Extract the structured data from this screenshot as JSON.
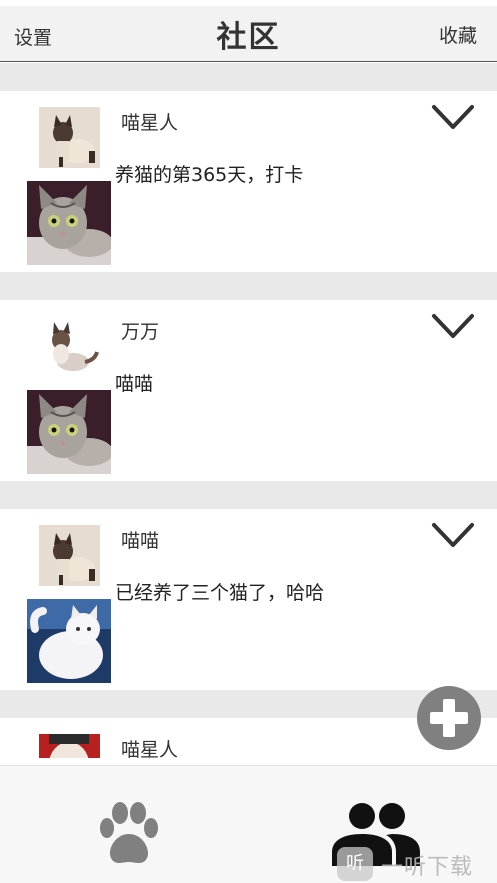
{
  "nav": {
    "left_label": "设置",
    "title": "社区",
    "right_label": "收藏"
  },
  "posts": [
    {
      "username": "喵星人",
      "text": "养猫的第365天，打卡",
      "avatar_icon": "siamese-cat-photo",
      "photo_icon": "tabby-cat-photo"
    },
    {
      "username": "万万",
      "text": "喵喵",
      "avatar_icon": "ragdoll-cat-photo",
      "photo_icon": "tabby-cat-photo"
    },
    {
      "username": "喵喵",
      "text": "已经养了三个猫了，哈哈",
      "avatar_icon": "siamese-cat-photo",
      "photo_icon": "white-persian-cat-photo"
    },
    {
      "username": "喵星人",
      "text": "",
      "avatar_icon": "cartoon-avatar-photo",
      "photo_icon": ""
    }
  ],
  "fab": {
    "icon": "plus-icon"
  },
  "tabs": [
    {
      "icon": "paw-icon"
    },
    {
      "icon": "users-icon"
    }
  ],
  "watermark": {
    "badge": "听",
    "text": "一听下载"
  },
  "colors": {
    "nav_bg": "#f2f2f2",
    "gap_bg": "#e9e9e9",
    "icon_gray": "#808080",
    "icon_dark": "#111111"
  }
}
